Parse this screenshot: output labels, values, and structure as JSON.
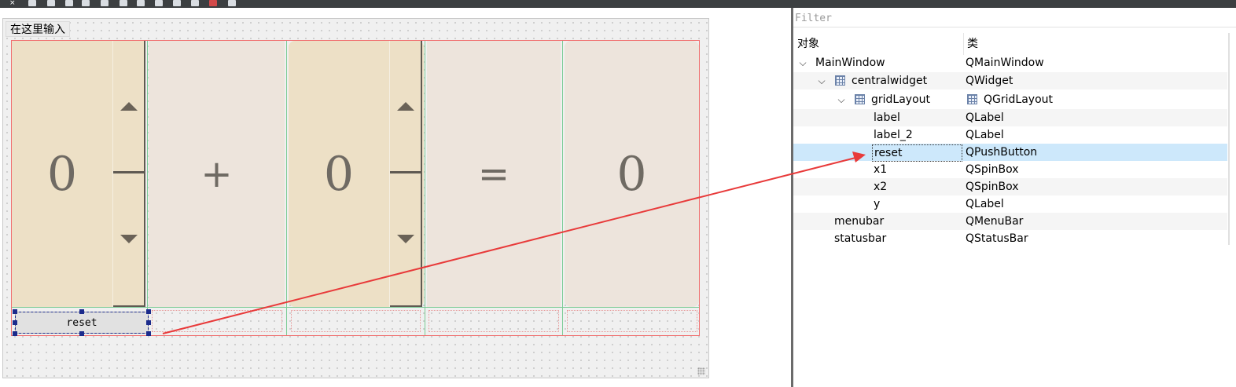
{
  "toolbar": {
    "icons": [
      "close-icon",
      "edit-widgets-icon",
      "edit-signals-icon",
      "edit-buddies-icon",
      "edit-tab-order-icon",
      "layout-horizontal-icon",
      "layout-vertical-icon",
      "layout-split-h-icon",
      "layout-split-v-icon",
      "layout-grid-icon",
      "layout-form-icon",
      "break-layout-icon",
      "adjust-size-icon"
    ]
  },
  "form": {
    "menu_placeholder": "在这里输入",
    "x1_value": "0",
    "plus_text": "+",
    "x2_value": "0",
    "equals_text": "=",
    "y_value": "0",
    "reset_label": "reset"
  },
  "inspector": {
    "filter_placeholder": "Filter",
    "col_object": "对象",
    "col_class": "类",
    "rows": [
      {
        "name": "MainWindow",
        "cls": "QMainWindow"
      },
      {
        "name": "centralwidget",
        "cls": "QWidget"
      },
      {
        "name": "gridLayout",
        "cls": "QGridLayout"
      },
      {
        "name": "label",
        "cls": "QLabel"
      },
      {
        "name": "label_2",
        "cls": "QLabel"
      },
      {
        "name": "reset",
        "cls": "QPushButton"
      },
      {
        "name": "x1",
        "cls": "QSpinBox"
      },
      {
        "name": "x2",
        "cls": "QSpinBox"
      },
      {
        "name": "y",
        "cls": "QLabel"
      },
      {
        "name": "menubar",
        "cls": "QMenuBar"
      },
      {
        "name": "statusbar",
        "cls": "QStatusBar"
      }
    ],
    "selected_row": "reset"
  },
  "colors": {
    "spinbox_bg": "#ede0c6",
    "label_bg": "#ede4dc",
    "selection_bg": "#cde8fb",
    "annotation_arrow": "#e83a3a",
    "layout_border": "#f07070",
    "selection_handle": "#1b2b8c"
  }
}
